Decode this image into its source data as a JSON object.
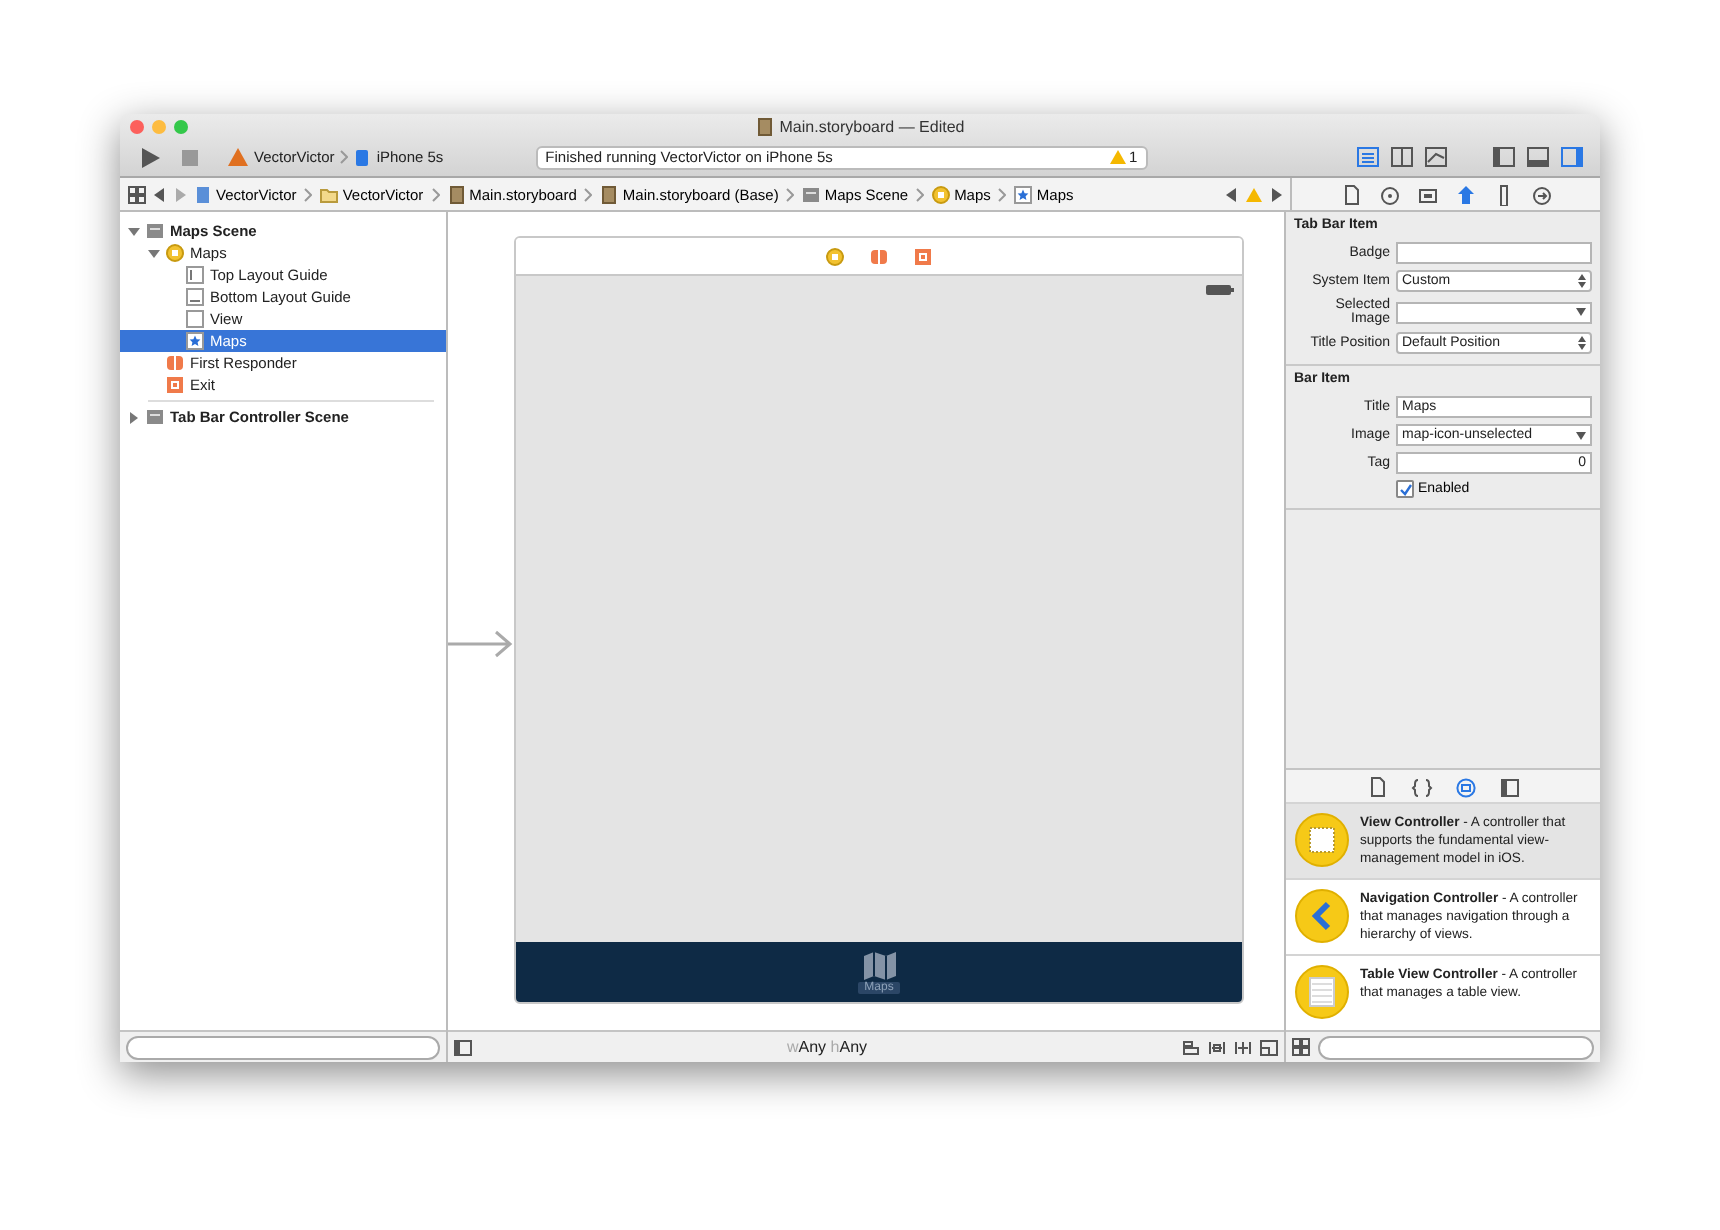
{
  "window": {
    "title": "Main.storyboard — Edited"
  },
  "toolbar": {
    "scheme": "VectorVictor",
    "device": "iPhone 5s",
    "status": "Finished running VectorVictor on iPhone 5s",
    "warning_count": "1",
    "editor_modes": [
      {
        "kind": "standard",
        "selected": true
      },
      {
        "kind": "assistant",
        "selected": false
      },
      {
        "kind": "version",
        "selected": false
      }
    ],
    "panels": [
      {
        "kind": "navigator",
        "selected": false
      },
      {
        "kind": "debug",
        "selected": false
      },
      {
        "kind": "utilities",
        "selected": true
      }
    ]
  },
  "breadcrumb": [
    {
      "label": "VectorVictor",
      "kind": "project"
    },
    {
      "label": "VectorVictor",
      "kind": "folder"
    },
    {
      "label": "Main.storyboard",
      "kind": "storyboard"
    },
    {
      "label": "Main.storyboard (Base)",
      "kind": "storyboard"
    },
    {
      "label": "Maps Scene",
      "kind": "scene"
    },
    {
      "label": "Maps",
      "kind": "controller"
    },
    {
      "label": "Maps",
      "kind": "star"
    }
  ],
  "navigator": {
    "tree": [
      {
        "label": "Maps Scene",
        "kind": "scene",
        "bold": true,
        "expanded": true,
        "selected": false,
        "children": [
          {
            "label": "Maps",
            "kind": "controller",
            "bold": false,
            "expanded": true,
            "selected": false,
            "children": [
              {
                "label": "Top Layout Guide",
                "kind": "top-guide",
                "bold": false,
                "selected": false
              },
              {
                "label": "Bottom Layout Guide",
                "kind": "bottom-guide",
                "bold": false,
                "selected": false
              },
              {
                "label": "View",
                "kind": "view",
                "bold": false,
                "selected": false
              },
              {
                "label": "Maps",
                "kind": "star",
                "bold": false,
                "selected": true
              }
            ]
          },
          {
            "label": "First Responder",
            "kind": "responder",
            "bold": false,
            "selected": false
          },
          {
            "label": "Exit",
            "kind": "exit",
            "bold": false,
            "selected": false
          }
        ]
      },
      {
        "label": "Tab Bar Controller Scene",
        "kind": "scene",
        "bold": true,
        "expanded": false,
        "selected": false
      }
    ]
  },
  "canvas": {
    "dock": [
      {
        "kind": "controller"
      },
      {
        "kind": "responder"
      },
      {
        "kind": "exit"
      }
    ],
    "tab_label": "Maps",
    "size_class": [
      {
        "prefix": "w",
        "value": "Any"
      },
      {
        "prefix": "h",
        "value": "Any"
      }
    ]
  },
  "inspector": {
    "tabs": [
      {
        "kind": "file",
        "selected": false
      },
      {
        "kind": "help",
        "selected": false
      },
      {
        "kind": "identity",
        "selected": false
      },
      {
        "kind": "attributes",
        "selected": true
      },
      {
        "kind": "size",
        "selected": false
      },
      {
        "kind": "connections",
        "selected": false
      }
    ],
    "sections": [
      {
        "title": "Tab Bar Item",
        "fields": [
          {
            "label": "Badge",
            "kind": "text"
          },
          {
            "label": "System Item",
            "kind": "popup",
            "value": "Custom"
          },
          {
            "label": "Selected Image",
            "kind": "combo"
          },
          {
            "label": "Title Position",
            "kind": "popup",
            "value": "Default Position"
          }
        ]
      },
      {
        "title": "Bar Item",
        "fields": [
          {
            "label": "Title",
            "kind": "text",
            "value": "Maps"
          },
          {
            "label": "Image",
            "kind": "combo",
            "value": "map-icon-unselected"
          },
          {
            "label": "Tag",
            "kind": "stepper",
            "value": "0"
          },
          {
            "label": "Enabled",
            "kind": "checkbox",
            "checked": true
          }
        ]
      }
    ]
  },
  "library": {
    "tabs": [
      {
        "kind": "file",
        "selected": false
      },
      {
        "kind": "code",
        "selected": false
      },
      {
        "kind": "object",
        "selected": true
      },
      {
        "kind": "media",
        "selected": false
      }
    ],
    "items": [
      {
        "kind": "view",
        "title": "View Controller",
        "description": " - A controller that supports the fundamental view-management model in iOS.",
        "selected": true
      },
      {
        "kind": "navigation",
        "title": "Navigation Controller",
        "description": " - A controller that manages navigation through a hierarchy of views.",
        "selected": false
      },
      {
        "kind": "table",
        "title": "Table View Controller",
        "description": " - A controller that manages a table view.",
        "selected": false
      }
    ]
  }
}
